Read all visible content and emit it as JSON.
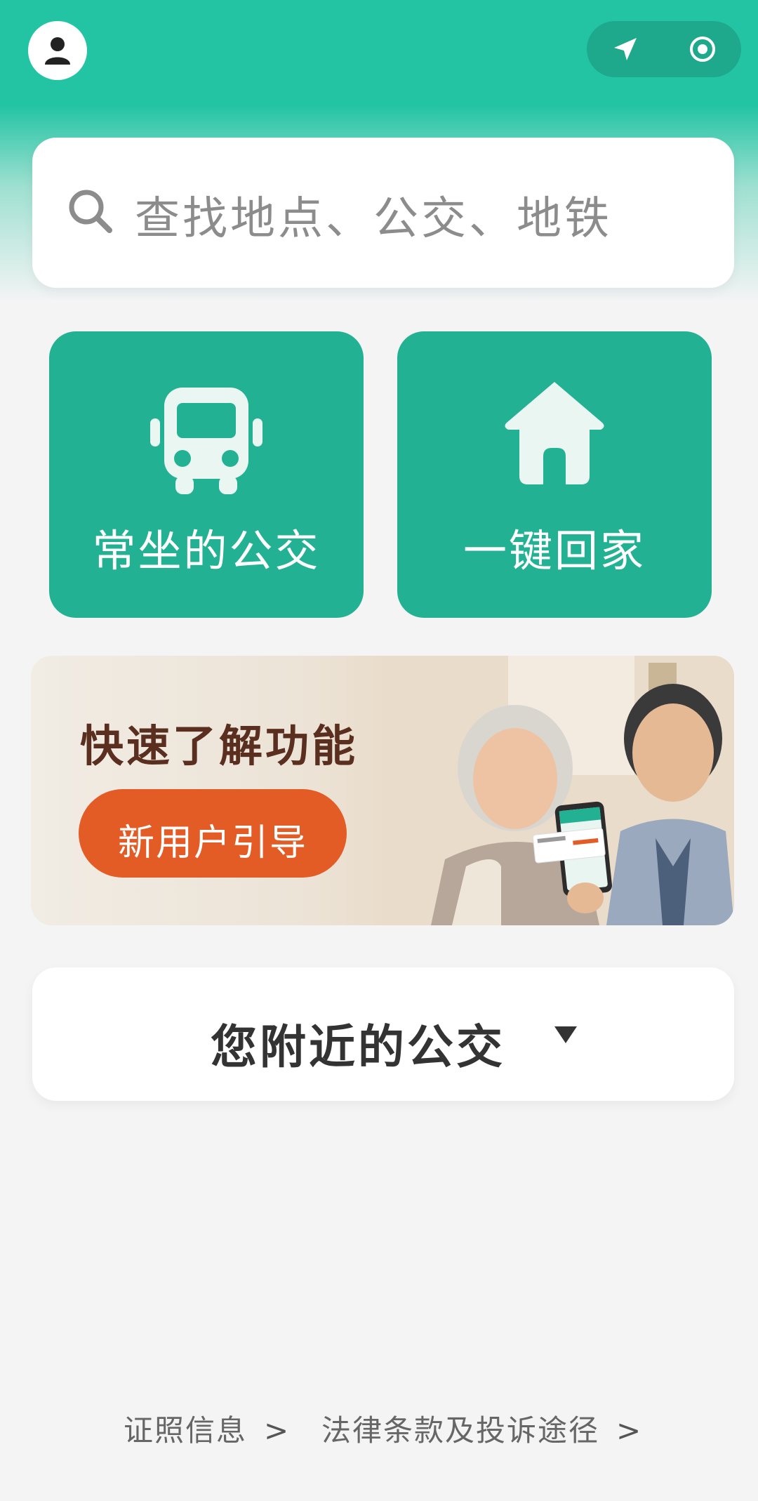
{
  "header": {
    "avatar_icon": "user-avatar-icon",
    "capsule": {
      "left_icon": "location-arrow-icon",
      "right_icon": "target-icon"
    }
  },
  "search": {
    "icon": "search-icon",
    "placeholder": "查找地点、公交、地铁"
  },
  "tiles": [
    {
      "icon": "bus-icon",
      "label": "常坐的公交"
    },
    {
      "icon": "home-icon",
      "label": "一键回家"
    }
  ],
  "banner": {
    "title": "快速了解功能",
    "button_label": "新用户引导"
  },
  "nearby": {
    "label": "您附近的公交",
    "icon": "caret-down-icon"
  },
  "footer": {
    "links": [
      {
        "label": "证照信息",
        "chevron": ">"
      },
      {
        "label": "法律条款及投诉途径",
        "chevron": ">"
      }
    ]
  },
  "colors": {
    "brand_green": "#23c4a4",
    "tile_green": "#22b293",
    "banner_button": "#e35c25",
    "banner_title": "#5a2f1f"
  }
}
